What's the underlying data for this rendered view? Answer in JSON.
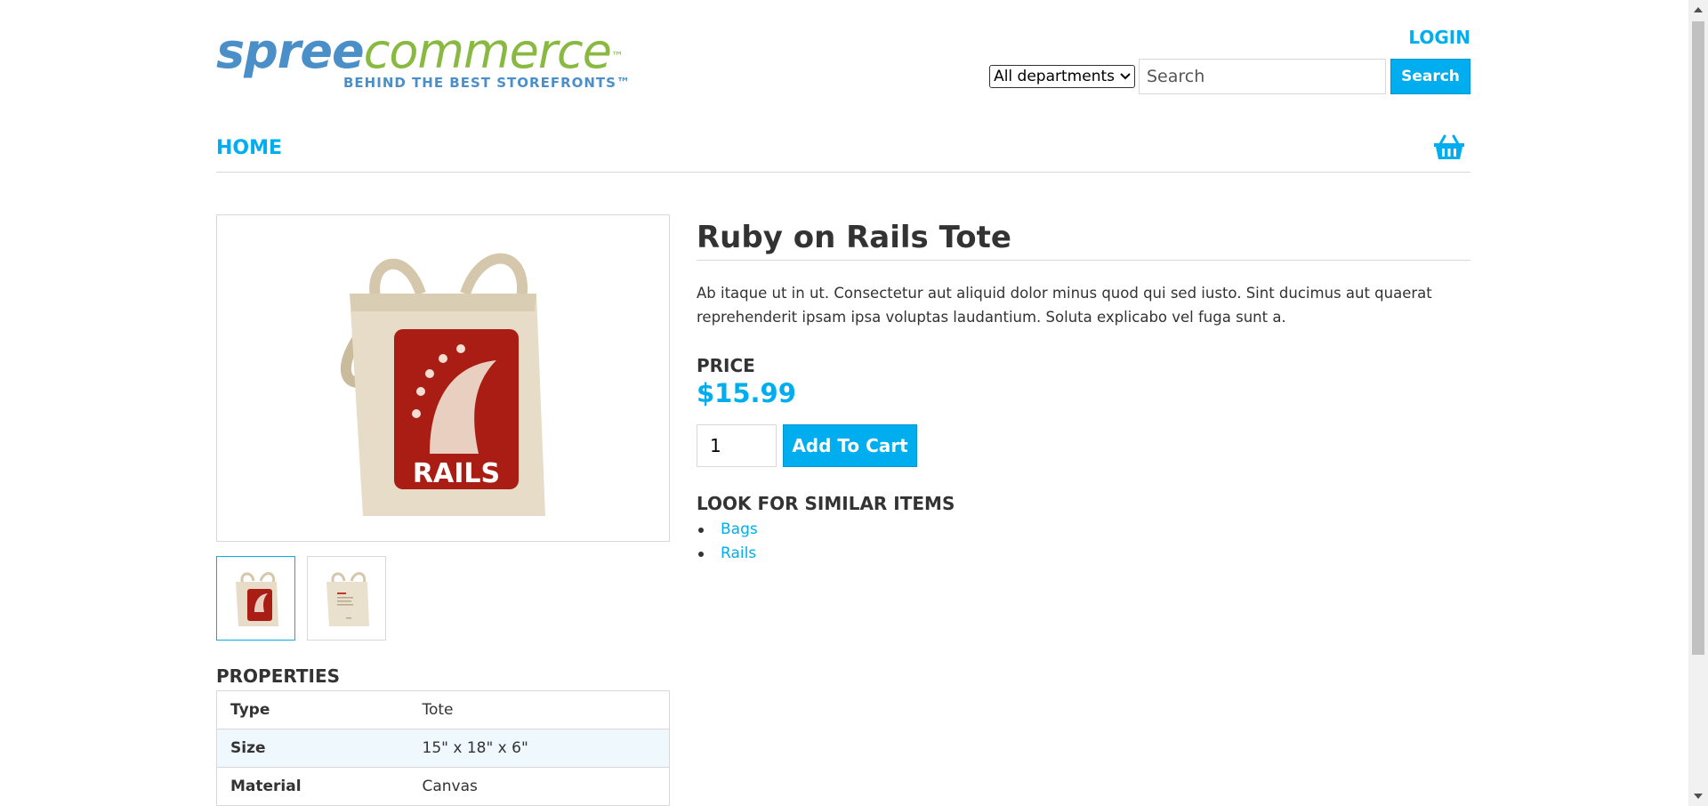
{
  "header": {
    "logo_primary": "spree",
    "logo_secondary": "commerce",
    "logo_tm": "™",
    "logo_tagline": "BEHIND THE BEST STOREFRONTS™",
    "login_label": "LOGIN"
  },
  "search": {
    "department_selected": "All departments",
    "placeholder": "Search",
    "button_label": "Search"
  },
  "nav": {
    "home_label": "HOME",
    "cart_icon": "basket-icon"
  },
  "product": {
    "title": "Ruby on Rails Tote",
    "description": "Ab itaque ut in ut. Consectetur aut aliquid dolor minus quod qui sed iusto. Sint ducimus aut quaerat reprehenderit ipsam ipsa voluptas laudantium. Soluta explicabo vel fuga sunt a.",
    "price_label": "PRICE",
    "price": "$15.99",
    "quantity": "1",
    "add_to_cart_label": "Add To Cart",
    "image_logo_text": "RAILS",
    "similar_title": "LOOK FOR SIMILAR ITEMS",
    "similar_items": [
      "Bags",
      "Rails"
    ]
  },
  "properties": {
    "title": "PROPERTIES",
    "rows": [
      {
        "key": "Type",
        "value": "Tote"
      },
      {
        "key": "Size",
        "value": "15\" x 18\" x 6\""
      },
      {
        "key": "Material",
        "value": "Canvas"
      }
    ]
  },
  "colors": {
    "accent": "#00adee",
    "logo_blue": "#4b8fc9",
    "logo_green": "#8ab941",
    "rails_red": "#a91d15"
  }
}
